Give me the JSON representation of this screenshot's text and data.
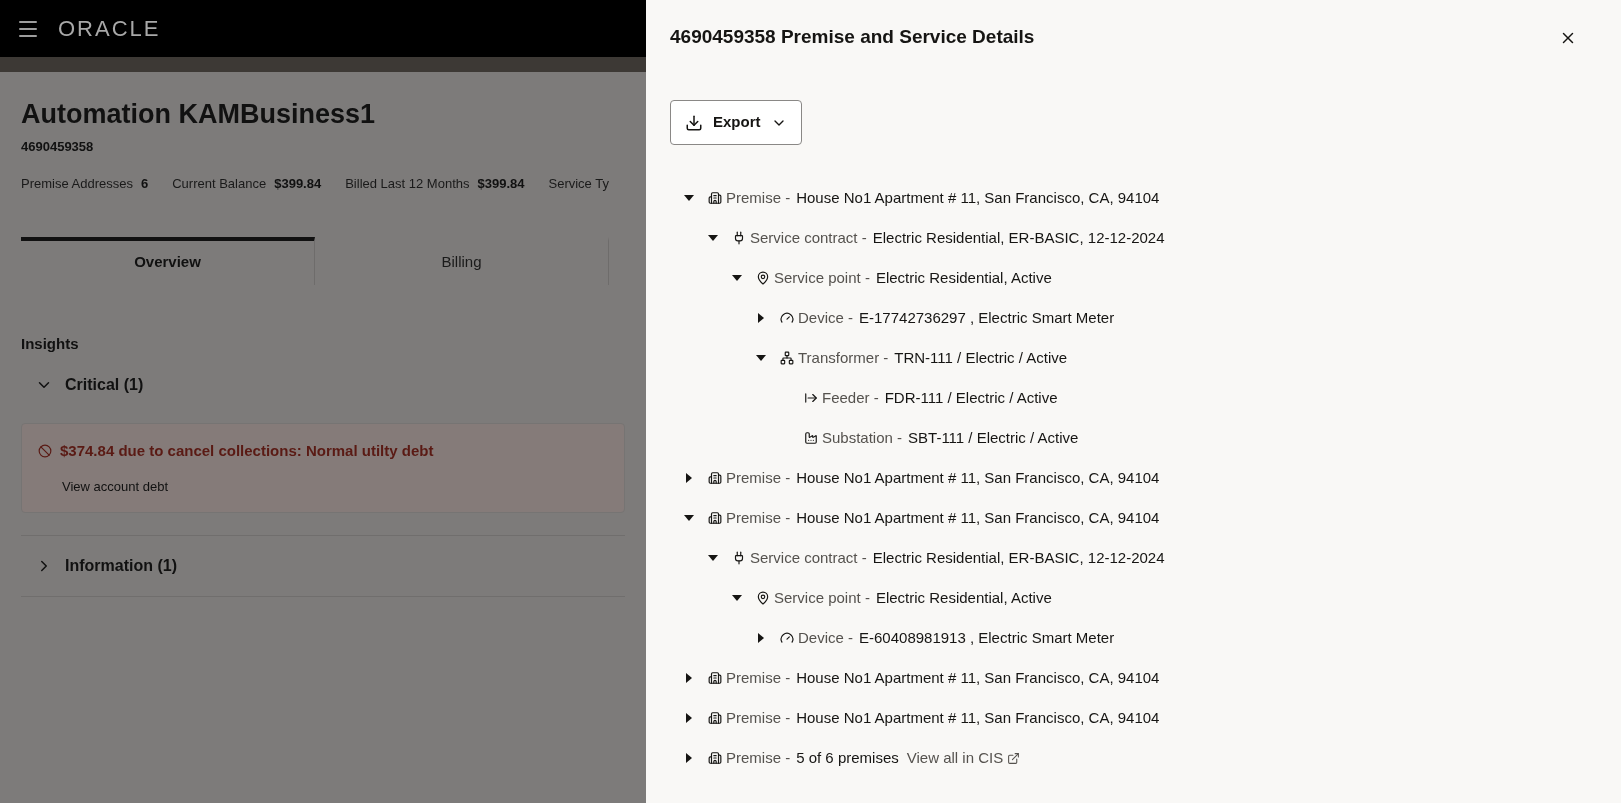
{
  "header": {
    "logo": "ORACLE"
  },
  "account": {
    "name": "Automation KAMBusiness1",
    "number": "4690459358",
    "stats": [
      {
        "label": "Premise Addresses",
        "value": "6"
      },
      {
        "label": "Current Balance",
        "value": "$399.84"
      },
      {
        "label": "Billed Last 12 Months",
        "value": "$399.84"
      },
      {
        "label": "Service Ty"
      }
    ]
  },
  "tabs": [
    {
      "label": "Overview",
      "selected": true
    },
    {
      "label": "Billing",
      "selected": false
    }
  ],
  "insights": {
    "title": "Insights",
    "groups": [
      {
        "label": "Critical (1)",
        "expanded": true,
        "alert": {
          "message": "$374.84 due to cancel collections: Normal utilty debt",
          "link": "View account debt"
        }
      },
      {
        "label": "Information (1)",
        "expanded": false
      }
    ]
  },
  "drawer": {
    "title": "4690459358 Premise and Service Details",
    "export_label": "Export",
    "tree": [
      {
        "kind": "premise",
        "label": "Premise -",
        "value": "House No1 Apartment # 11, San Francisco, CA, 94104",
        "expanded": true,
        "children": [
          {
            "kind": "contract",
            "label": "Service contract -",
            "value": "Electric Residential, ER-BASIC, 12-12-2024",
            "expanded": true,
            "children": [
              {
                "kind": "point",
                "label": "Service point -",
                "value": "Electric Residential, Active",
                "expanded": true,
                "children": [
                  {
                    "kind": "device",
                    "label": "Device -",
                    "value": "E-17742736297 , Electric Smart Meter",
                    "expanded": false
                  },
                  {
                    "kind": "transformer",
                    "label": "Transformer -",
                    "value": "TRN-111 / Electric / Active",
                    "expanded": true,
                    "children": [
                      {
                        "kind": "feeder",
                        "label": "Feeder -",
                        "value": "FDR-111 / Electric / Active"
                      },
                      {
                        "kind": "substation",
                        "label": "Substation -",
                        "value": "SBT-111 / Electric / Active"
                      }
                    ]
                  }
                ]
              }
            ]
          }
        ]
      },
      {
        "kind": "premise",
        "label": "Premise -",
        "value": "House No1 Apartment # 11, San Francisco, CA, 94104",
        "expanded": false
      },
      {
        "kind": "premise",
        "label": "Premise -",
        "value": "House No1 Apartment # 11, San Francisco, CA, 94104",
        "expanded": true,
        "children": [
          {
            "kind": "contract",
            "label": "Service contract -",
            "value": "Electric Residential, ER-BASIC, 12-12-2024",
            "expanded": true,
            "children": [
              {
                "kind": "point",
                "label": "Service point -",
                "value": "Electric Residential, Active",
                "expanded": true,
                "children": [
                  {
                    "kind": "device",
                    "label": "Device -",
                    "value": "E-60408981913 , Electric Smart Meter",
                    "expanded": false
                  }
                ]
              }
            ]
          }
        ]
      },
      {
        "kind": "premise",
        "label": "Premise -",
        "value": "House No1 Apartment # 11, San Francisco, CA, 94104",
        "expanded": false
      },
      {
        "kind": "premise",
        "label": "Premise -",
        "value": "House No1 Apartment # 11, San Francisco, CA, 94104",
        "expanded": false
      },
      {
        "kind": "premise",
        "label": "Premise -",
        "value": "5 of 6 premises",
        "link": "View all in CIS",
        "expanded": false
      }
    ]
  }
}
